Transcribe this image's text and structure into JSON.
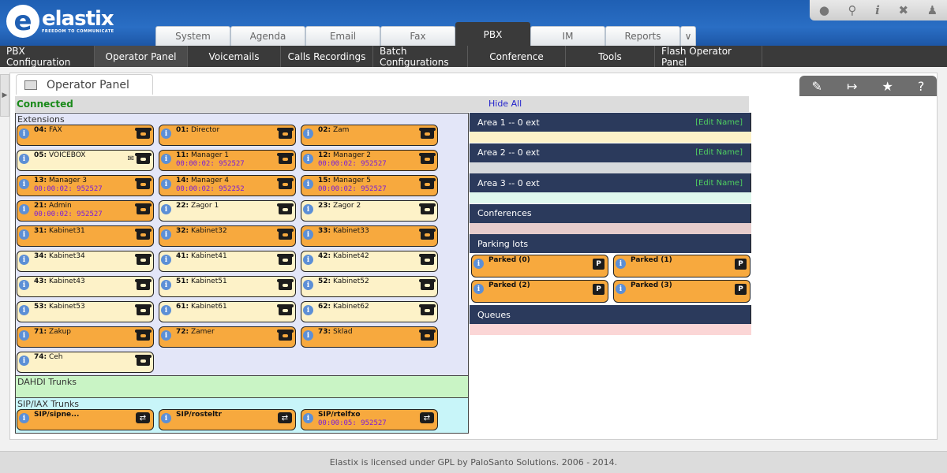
{
  "app": {
    "logo_name": "elastix",
    "logo_tagline": "FREEDOM TO COMMUNICATE"
  },
  "tabs": [
    "System",
    "Agenda",
    "Email",
    "Fax",
    "PBX",
    "IM",
    "Reports"
  ],
  "active_tab": "PBX",
  "top_icons": [
    "drop-icon",
    "search-icon",
    "info-icon",
    "tools-icon",
    "user-icon"
  ],
  "subnav": [
    "PBX Configuration",
    "Operator Panel",
    "Voicemails",
    "Calls Recordings",
    "Batch Configurations",
    "Conference",
    "Tools",
    "Flash Operator Panel"
  ],
  "active_subnav": "Operator Panel",
  "panel": {
    "title": "Operator Panel",
    "tools": [
      "edit-icon",
      "export-icon",
      "star-icon",
      "help-icon"
    ]
  },
  "status": {
    "connected": "Connected",
    "hide_all": "Hide All"
  },
  "sections": {
    "extensions": "Extensions",
    "dahdi": "DAHDI Trunks",
    "sip": "SIP/IAX Trunks"
  },
  "extensions": [
    {
      "num": "04:",
      "name": "FAX",
      "time": "",
      "busy": true,
      "mail": false
    },
    {
      "num": "01:",
      "name": "Director",
      "time": "",
      "busy": true,
      "mail": false
    },
    {
      "num": "02:",
      "name": "Zam",
      "time": "",
      "busy": true,
      "mail": false
    },
    {
      "num": "05:",
      "name": "VOICEBOX",
      "time": "",
      "busy": false,
      "mail": true
    },
    {
      "num": "11:",
      "name": "Manager 1",
      "time": "00:00:02: 952527",
      "busy": true,
      "mail": false
    },
    {
      "num": "12:",
      "name": "Manager 2",
      "time": "00:00:02: 952527",
      "busy": true,
      "mail": false
    },
    {
      "num": "13:",
      "name": "Manager 3",
      "time": "00:00:02: 952527",
      "busy": true,
      "mail": false
    },
    {
      "num": "14:",
      "name": "Manager 4",
      "time": "00:00:02: 952252",
      "busy": true,
      "mail": false
    },
    {
      "num": "15:",
      "name": "Manager 5",
      "time": "00:00:02: 952527",
      "busy": true,
      "mail": false
    },
    {
      "num": "21:",
      "name": "Admin",
      "time": "00:00:02: 952527",
      "busy": true,
      "mail": false
    },
    {
      "num": "22:",
      "name": "Zagor 1",
      "time": "",
      "busy": false,
      "mail": false
    },
    {
      "num": "23:",
      "name": "Zagor 2",
      "time": "",
      "busy": false,
      "mail": false
    },
    {
      "num": "31:",
      "name": "Kabinet31",
      "time": "",
      "busy": true,
      "mail": false
    },
    {
      "num": "32:",
      "name": "Kabinet32",
      "time": "",
      "busy": true,
      "mail": false
    },
    {
      "num": "33:",
      "name": "Kabinet33",
      "time": "",
      "busy": true,
      "mail": false
    },
    {
      "num": "34:",
      "name": "Kabinet34",
      "time": "",
      "busy": false,
      "mail": false
    },
    {
      "num": "41:",
      "name": "Kabinet41",
      "time": "",
      "busy": false,
      "mail": false
    },
    {
      "num": "42:",
      "name": "Kabinet42",
      "time": "",
      "busy": false,
      "mail": false
    },
    {
      "num": "43:",
      "name": "Kabinet43",
      "time": "",
      "busy": false,
      "mail": false
    },
    {
      "num": "51:",
      "name": "Kabinet51",
      "time": "",
      "busy": false,
      "mail": false
    },
    {
      "num": "52:",
      "name": "Kabinet52",
      "time": "",
      "busy": false,
      "mail": false
    },
    {
      "num": "53:",
      "name": "Kabinet53",
      "time": "",
      "busy": false,
      "mail": false
    },
    {
      "num": "61:",
      "name": "Kabinet61",
      "time": "",
      "busy": false,
      "mail": false
    },
    {
      "num": "62:",
      "name": "Kabinet62",
      "time": "",
      "busy": false,
      "mail": false
    },
    {
      "num": "71:",
      "name": "Zakup",
      "time": "",
      "busy": true,
      "mail": false
    },
    {
      "num": "72:",
      "name": "Zamer",
      "time": "",
      "busy": true,
      "mail": false
    },
    {
      "num": "73:",
      "name": "Sklad",
      "time": "",
      "busy": true,
      "mail": false
    },
    {
      "num": "74:",
      "name": "Ceh",
      "time": "",
      "busy": false,
      "mail": false
    }
  ],
  "trunks": [
    {
      "name": "SIP/sipne...",
      "time": ""
    },
    {
      "name": "SIP/rosteltr",
      "time": ""
    },
    {
      "name": "SIP/rtelfxo",
      "time": "00:00:05: 952527"
    }
  ],
  "areas": [
    {
      "title": "Area 1 -- 0 ext",
      "edit": "[Edit Name]",
      "color": "#fdf2c8"
    },
    {
      "title": "Area 2 -- 0 ext",
      "edit": "[Edit Name]",
      "color": "#d6d9dc"
    },
    {
      "title": "Area 3 -- 0 ext",
      "edit": "[Edit Name]",
      "color": "#dff8ee"
    }
  ],
  "conferences": {
    "title": "Conferences",
    "color": "#e6cccc"
  },
  "parking": {
    "title": "Parking lots",
    "items": [
      "Parked (0)",
      "Parked (1)",
      "Parked (2)",
      "Parked (3)"
    ],
    "badge": "P"
  },
  "queues": {
    "title": "Queues",
    "color": "#fbd6d6"
  },
  "footer": "Elastix is licensed under GPL by PaloSanto Solutions. 2006 - 2014."
}
